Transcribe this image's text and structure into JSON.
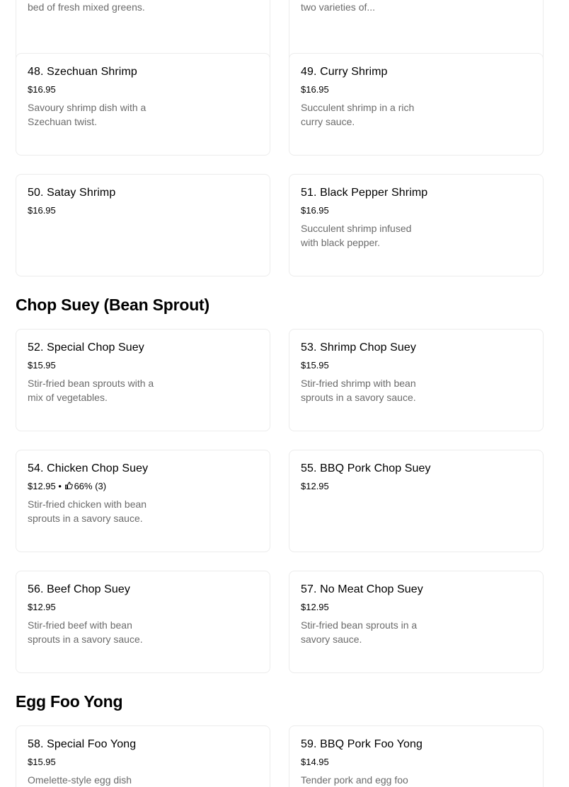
{
  "sections": {
    "shrimp": {
      "items": [
        {
          "name": "",
          "price": "",
          "desc": "Succulent shrimp served on a bed of fresh mixed greens."
        },
        {
          "name": "",
          "price": "",
          "desc": "Succulent shrimp paired with two varieties of..."
        },
        {
          "name": "48. Szechuan Shrimp",
          "price": "$16.95",
          "desc": "Savoury shrimp dish with a Szechuan twist."
        },
        {
          "name": "49. Curry Shrimp",
          "price": "$16.95",
          "desc": "Succulent shrimp in a rich curry sauce."
        },
        {
          "name": "50. Satay Shrimp",
          "price": "$16.95",
          "desc": ""
        },
        {
          "name": "51. Black Pepper Shrimp",
          "price": "$16.95",
          "desc": "Succulent shrimp infused with black pepper."
        }
      ]
    },
    "chop_suey": {
      "heading": "Chop Suey (Bean Sprout)",
      "items": [
        {
          "name": "52. Special Chop Suey",
          "price": "$15.95",
          "desc": "Stir-fried bean sprouts with a mix of vegetables."
        },
        {
          "name": "53. Shrimp Chop Suey",
          "price": "$15.95",
          "desc": "Stir-fried shrimp with bean sprouts in a savory sauce."
        },
        {
          "name": "54. Chicken Chop Suey",
          "price": "$12.95",
          "separator": "•",
          "rating": "66% (3)",
          "desc": "Stir-fried chicken with bean sprouts in a savory sauce."
        },
        {
          "name": "55. BBQ Pork Chop Suey",
          "price": "$12.95",
          "desc": ""
        },
        {
          "name": "56. Beef Chop Suey",
          "price": "$12.95",
          "desc": "Stir-fried beef with bean sprouts in a savory sauce."
        },
        {
          "name": "57. No Meat Chop Suey",
          "price": "$12.95",
          "desc": "Stir-fried bean sprouts in a savory sauce."
        }
      ]
    },
    "egg_foo_yong": {
      "heading": "Egg Foo Yong",
      "items": [
        {
          "name": "58. Special Foo Yong",
          "price": "$15.95",
          "desc": "Omelette-style egg dish"
        },
        {
          "name": "59. BBQ Pork Foo Yong",
          "price": "$14.95",
          "desc": "Tender pork and egg foo"
        }
      ]
    }
  },
  "icons": {
    "rating": "thumbs-up-icon"
  }
}
